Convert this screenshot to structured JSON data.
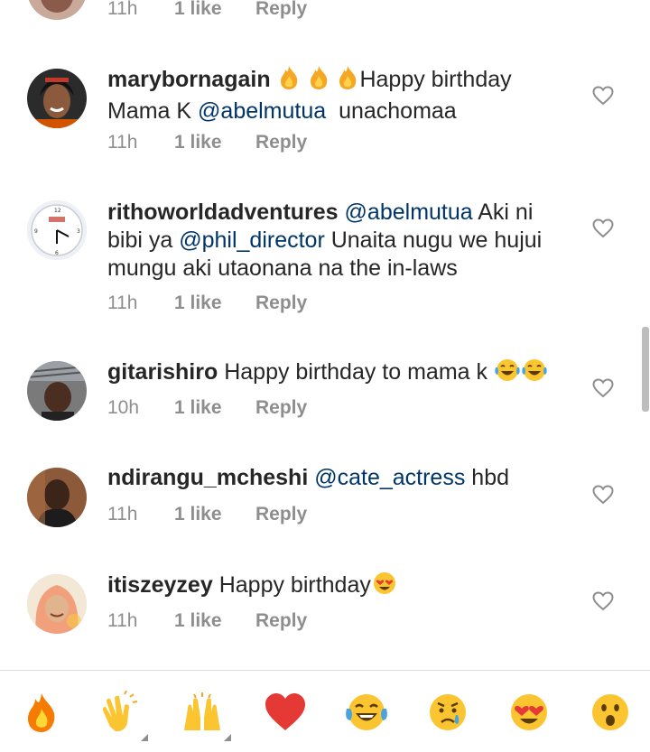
{
  "comments": [
    {
      "username": "",
      "text_parts": [],
      "time": "11h",
      "likes": "1 like",
      "reply": "Reply"
    },
    {
      "username": "marybornagain",
      "text_parts": [
        {
          "type": "emoji",
          "name": "fire-icon"
        },
        {
          "type": "emoji",
          "name": "fire-icon"
        },
        {
          "type": "emoji",
          "name": "fire-icon"
        },
        {
          "type": "text",
          "value": "Happy birthday Mama K "
        },
        {
          "type": "mention",
          "value": "@abelmutua"
        },
        {
          "type": "text",
          "value": "  unachomaa"
        }
      ],
      "time": "11h",
      "likes": "1 like",
      "reply": "Reply"
    },
    {
      "username": "rithoworldadventures",
      "text_parts": [
        {
          "type": "mention",
          "value": "@abelmutua"
        },
        {
          "type": "text",
          "value": " Aki ni bibi ya "
        },
        {
          "type": "mention",
          "value": "@phil_director"
        },
        {
          "type": "text",
          "value": " Unaita nugu we hujui mungu aki utaonana na the in-laws"
        }
      ],
      "time": "11h",
      "likes": "1 like",
      "reply": "Reply"
    },
    {
      "username": "gitarishiro",
      "text_parts": [
        {
          "type": "text",
          "value": "Happy birthday to mama k "
        },
        {
          "type": "emoji",
          "name": "tears-of-joy-icon"
        },
        {
          "type": "emoji",
          "name": "tears-of-joy-icon"
        }
      ],
      "time": "10h",
      "likes": "1 like",
      "reply": "Reply"
    },
    {
      "username": "ndirangu_mcheshi",
      "text_parts": [
        {
          "type": "mention",
          "value": "@cate_actress"
        },
        {
          "type": "text",
          "value": " hbd"
        }
      ],
      "time": "11h",
      "likes": "1 like",
      "reply": "Reply"
    },
    {
      "username": "itiszeyzey",
      "text_parts": [
        {
          "type": "text",
          "value": "Happy birthday"
        },
        {
          "type": "emoji",
          "name": "heart-eyes-icon"
        }
      ],
      "time": "11h",
      "likes": "1 like",
      "reply": "Reply"
    }
  ],
  "emoji_bar": [
    {
      "name": "fire-icon"
    },
    {
      "name": "clapping-hands-icon"
    },
    {
      "name": "raising-hands-icon"
    },
    {
      "name": "red-heart-icon"
    },
    {
      "name": "tears-of-joy-icon"
    },
    {
      "name": "crying-face-icon"
    },
    {
      "name": "heart-eyes-icon"
    },
    {
      "name": "surprised-face-icon"
    }
  ],
  "colors": {
    "text": "#262626",
    "muted": "#8e8e8e",
    "mention": "#003569",
    "divider": "#dbdbdb"
  }
}
